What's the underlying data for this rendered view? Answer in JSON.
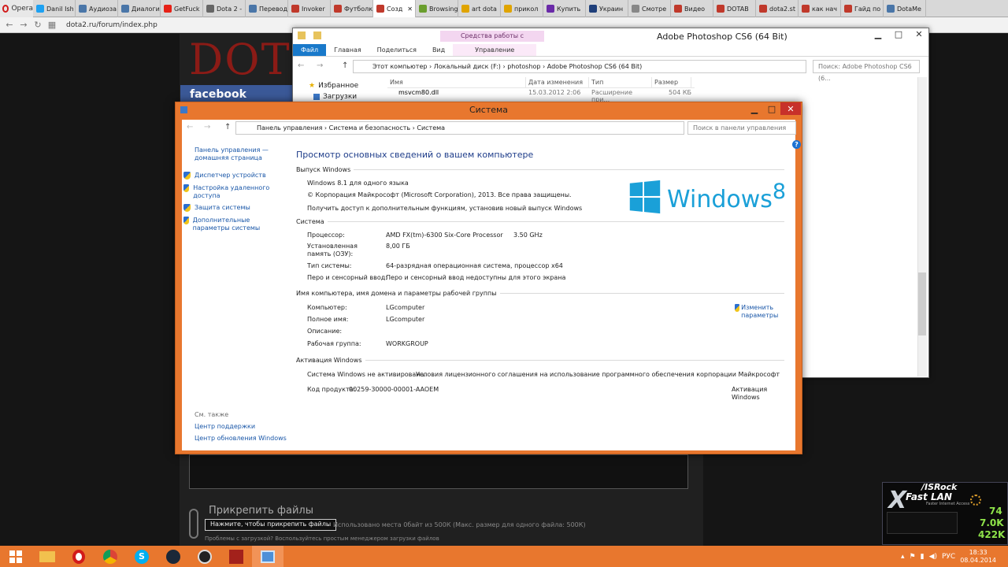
{
  "browser": {
    "menu_label": "Opera",
    "tabs": [
      {
        "label": "Danil Ish",
        "color": "#1da1f2"
      },
      {
        "label": "Аудиоза",
        "color": "#4a76a8"
      },
      {
        "label": "Диалоги",
        "color": "#4a76a8"
      },
      {
        "label": "GetFuck",
        "color": "#e62117"
      },
      {
        "label": "Dota 2 -",
        "color": "#666666"
      },
      {
        "label": "Перевод",
        "color": "#4a76a8"
      },
      {
        "label": "Invoker",
        "color": "#c0392b"
      },
      {
        "label": "Футболк",
        "color": "#c0392b"
      },
      {
        "label": "Созд",
        "color": "#c0392b",
        "active": true
      },
      {
        "label": "Browsing",
        "color": "#6a9e2d"
      },
      {
        "label": "art dota",
        "color": "#e0a400"
      },
      {
        "label": "прикол",
        "color": "#e0a400"
      },
      {
        "label": "Купить",
        "color": "#6a2aa8"
      },
      {
        "label": "Украин",
        "color": "#1f3f7a"
      },
      {
        "label": "Смотре",
        "color": "#888888"
      },
      {
        "label": "Видео",
        "color": "#c0392b"
      },
      {
        "label": "DOTAB",
        "color": "#c0392b"
      },
      {
        "label": "dota2.st",
        "color": "#c0392b"
      },
      {
        "label": "как нач",
        "color": "#c0392b"
      },
      {
        "label": "Гайд по",
        "color": "#c0392b"
      },
      {
        "label": "DotaMe",
        "color": "#4a76a8"
      }
    ],
    "url": "dota2.ru/forum/index.php"
  },
  "page": {
    "logo_letters": "DOT",
    "facebook_label": "facebook",
    "attach_title": "Прикрепить файлы",
    "attach_button": "Нажмите, чтобы прикрепить файлы",
    "attach_info": "Использовано места 0байт из 500К (Макс. размер для одного файла: 500К)",
    "attach_problem": "Проблемы с загрузкой? Воспользуйтесь простым менеджером загрузки файлов"
  },
  "explorer": {
    "context_tab": "Средства работы с приложениями",
    "title": "Adobe Photoshop CS6 (64 Bit)",
    "ribbon": [
      "Файл",
      "Главная",
      "Поделиться",
      "Вид"
    ],
    "ribbon_ctx": "Управление",
    "path": "Этот компьютер  ›  Локальный диск (F:)  ›  photoshop  ›  Adobe Photoshop CS6 (64 Bit)",
    "search_placeholder": "Поиск: Adobe Photoshop CS6 (6...",
    "nav": [
      "Избранное",
      "Загрузки"
    ],
    "columns": [
      "Имя",
      "Дата изменения",
      "Тип",
      "Размер"
    ],
    "rows": [
      {
        "name": "msvcm80.dll",
        "date": "15.03.2012 2:06",
        "type": "Расширение при...",
        "size": "504 КБ"
      }
    ]
  },
  "system": {
    "title": "Система",
    "path": "Панель управления  ›  Система и безопасность  ›  Система",
    "search_placeholder": "Поиск в панели управления",
    "sidebar": {
      "home": "Панель управления — домашняя страница",
      "links": [
        "Диспетчер устройств",
        "Настройка удаленного доступа",
        "Защита системы",
        "Дополнительные параметры системы"
      ],
      "see_also": "См. также",
      "see_also_links": [
        "Центр поддержки",
        "Центр обновления Windows"
      ]
    },
    "heading": "Просмотр основных сведений о вашем компьютере",
    "edition": {
      "header": "Выпуск Windows",
      "name": "Windows 8.1 для одного языка",
      "copyright": "© Корпорация Майкрософт (Microsoft Corporation), 2013. Все права защищены.",
      "upgrade_link": "Получить доступ к дополнительным функциям, установив новый выпуск Windows",
      "logo_text": "Windows",
      "logo_version": "8"
    },
    "sysinfo": {
      "header": "Система",
      "rows": [
        {
          "label": "Процессор:",
          "value": "AMD FX(tm)-6300 Six-Core Processor",
          "extra": "3.50 GHz"
        },
        {
          "label": "Установленная память (ОЗУ):",
          "value": "8,00 ГБ"
        },
        {
          "label": "Тип системы:",
          "value": "64-разрядная операционная система, процессор x64"
        },
        {
          "label": "Перо и сенсорный ввод:",
          "value": "Перо и сенсорный ввод недоступны для этого экрана"
        }
      ]
    },
    "computer": {
      "header": "Имя компьютера, имя домена и параметры рабочей группы",
      "rows": [
        {
          "label": "Компьютер:",
          "value": "LGcomputer"
        },
        {
          "label": "Полное имя:",
          "value": "LGcomputer"
        },
        {
          "label": "Описание:",
          "value": ""
        },
        {
          "label": "Рабочая группа:",
          "value": "WORKGROUP"
        }
      ],
      "change_link": "Изменить параметры"
    },
    "activation": {
      "header": "Активация Windows",
      "status": "Система Windows не активирована.",
      "license_link": "Условия лицензионного соглашения на использование программного обеспечения корпорации Майкрософт",
      "product_key_label": "Код продукта:",
      "product_key": "00259-30000-00001-AAOEM",
      "activate_link": "Активация Windows"
    }
  },
  "widget": {
    "brand": "/ISRock",
    "x": "X",
    "name": "Fast LAN",
    "sub": "Faster Internet Access",
    "values": [
      "74",
      "7.0K",
      "422K"
    ]
  },
  "taskbar": {
    "lang": "РУС",
    "time": "18:33",
    "date": "08.04.2014"
  }
}
